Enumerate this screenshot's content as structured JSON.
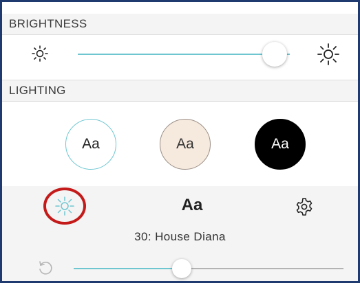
{
  "brightness": {
    "header": "BRIGHTNESS",
    "low_icon": "sun-small-icon",
    "high_icon": "sun-large-icon",
    "level": 0.93
  },
  "lighting": {
    "header": "LIGHTING",
    "themes": [
      {
        "label": "Aa",
        "name": "white",
        "bg": "#ffffff",
        "fg": "#222222",
        "border": "#6ec6d1",
        "selected": true
      },
      {
        "label": "Aa",
        "name": "sepia",
        "bg": "#f6e9dd",
        "fg": "#333333",
        "border": "#9a8e86",
        "selected": false
      },
      {
        "label": "Aa",
        "name": "black",
        "bg": "#000000",
        "fg": "#ffffff",
        "border": "#000000",
        "selected": false
      }
    ]
  },
  "toolbar": {
    "brightness_icon": "sun-icon",
    "font_label": "Aa",
    "settings_icon": "gear-icon",
    "font_name": "30: House Diana",
    "reset_icon": "undo-icon",
    "font_slider_level": 0.4
  },
  "colors": {
    "accent": "#6ec6d1",
    "highlight": "#c41a1a",
    "frame": "#1e3a6e"
  }
}
